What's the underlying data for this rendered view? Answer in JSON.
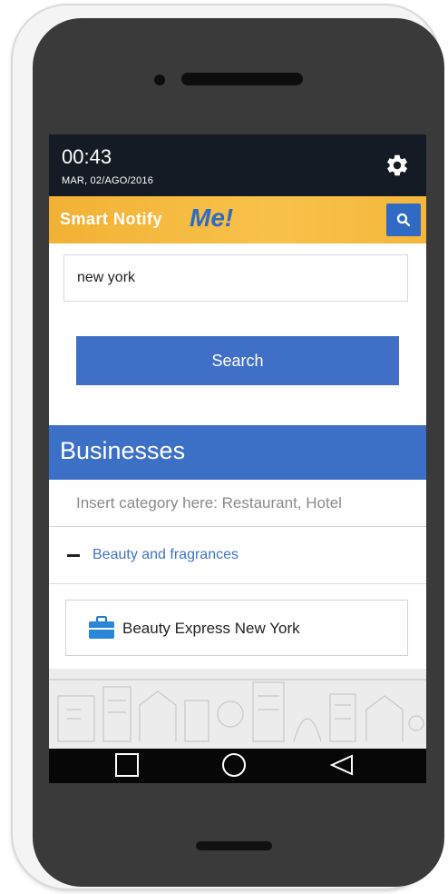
{
  "status": {
    "time": "00:43",
    "date": "MAR, 02/AGO/2016"
  },
  "app": {
    "brand_name": "Smart Notify",
    "brand_suffix": "Me!"
  },
  "search": {
    "value": "new york",
    "button_label": "Search"
  },
  "section": {
    "title": "Businesses",
    "category_placeholder": "Insert category here: Restaurant, Hotel"
  },
  "categories": [
    {
      "label": "Beauty and fragrances",
      "expanded": true,
      "businesses": [
        {
          "name": "Beauty Express New York",
          "icon": "briefcase-icon"
        }
      ]
    }
  ],
  "colors": {
    "status_bar": "#141b25",
    "app_bar": "#f4b63c",
    "accent_blue": "#3b70c6",
    "link_blue": "#3f74c5",
    "phone_frame": "#3a3a3a"
  },
  "icons": {
    "settings": "gear-icon",
    "app_search": "search-icon",
    "collapse": "minus-icon",
    "nav_recent": "square-icon",
    "nav_home": "circle-icon",
    "nav_back": "triangle-back-icon"
  }
}
